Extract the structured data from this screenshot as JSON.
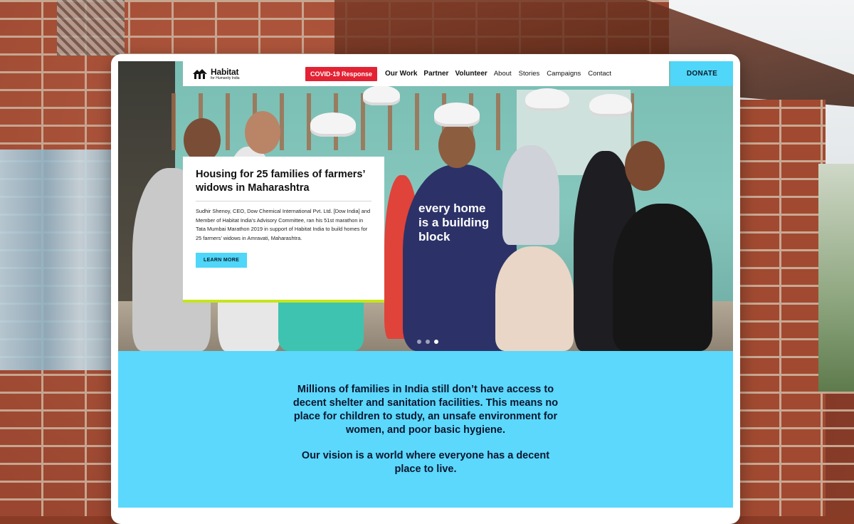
{
  "nav": {
    "logo_title": "Habitat",
    "logo_subtitle": "for Humanity India",
    "covid_label": "COVID-19 Response",
    "primary_links": [
      "Our Work",
      "Partner",
      "Volunteer"
    ],
    "secondary_links": [
      "About",
      "Stories",
      "Campaigns",
      "Contact"
    ],
    "donate_label": "DONATE"
  },
  "hero": {
    "slide_count": 3,
    "active_slide": 3,
    "card": {
      "title": "Housing for 25 families of farmers’ widows in Maharashtra",
      "body": "Sudhir Shenoy, CEO, Dow Chemical International Pvt. Ltd. [Dow India] and Member of Habitat India’s Advisory Committee, ran his 51st marathon in Tata Mumbai Marathon 2019 in support of Habitat India to build homes for 25 farmers’ widows in Amravati, Maharashtra.",
      "button_label": "LEARN MORE"
    },
    "tshirt_text": "every home is a building block"
  },
  "mission": {
    "paragraph_1": "Millions of families in India still don’t have access to decent shelter and sanitation facilities. This means no place for children to study, an unsafe environment for women, and poor basic hygiene.",
    "paragraph_2": "Our vision is a world where everyone has a decent place to live."
  },
  "colors": {
    "accent_cyan": "#4fd6f8",
    "mission_bg": "#5bd8fb",
    "covid_red": "#e32233",
    "card_underline": "#c6e51a"
  }
}
